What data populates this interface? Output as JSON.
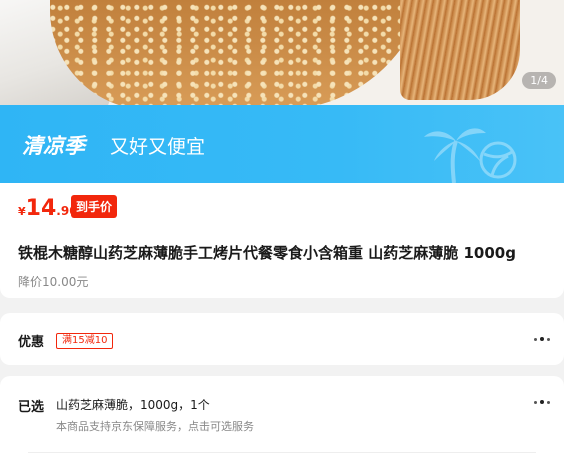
{
  "gallery": {
    "page_indicator": "1/4"
  },
  "banner": {
    "brand": "清凉季",
    "slogan": "又好又便宜",
    "palm_icon": "palm-tree-icon",
    "ball_icon": "beach-ball-icon"
  },
  "price": {
    "currency": "¥",
    "integer": "14",
    "decimal": ".90",
    "tag": "到手价",
    "color": "#f2270c"
  },
  "product": {
    "title": "铁棍木糖醇山药芝麻薄脆手工烤片代餐零食小含箱重 山药芝麻薄脆 1000g",
    "reduced": "降价10.00元"
  },
  "promo": {
    "label": "优惠",
    "coupon": "满15减10"
  },
  "selection": {
    "label": "已选",
    "spec": "山药芝麻薄脆，1000g，1个",
    "service": "本商品支持京东保障服务，点击可选服务"
  },
  "colors": {
    "banner": "#37baf6",
    "accent": "#f2270c"
  }
}
